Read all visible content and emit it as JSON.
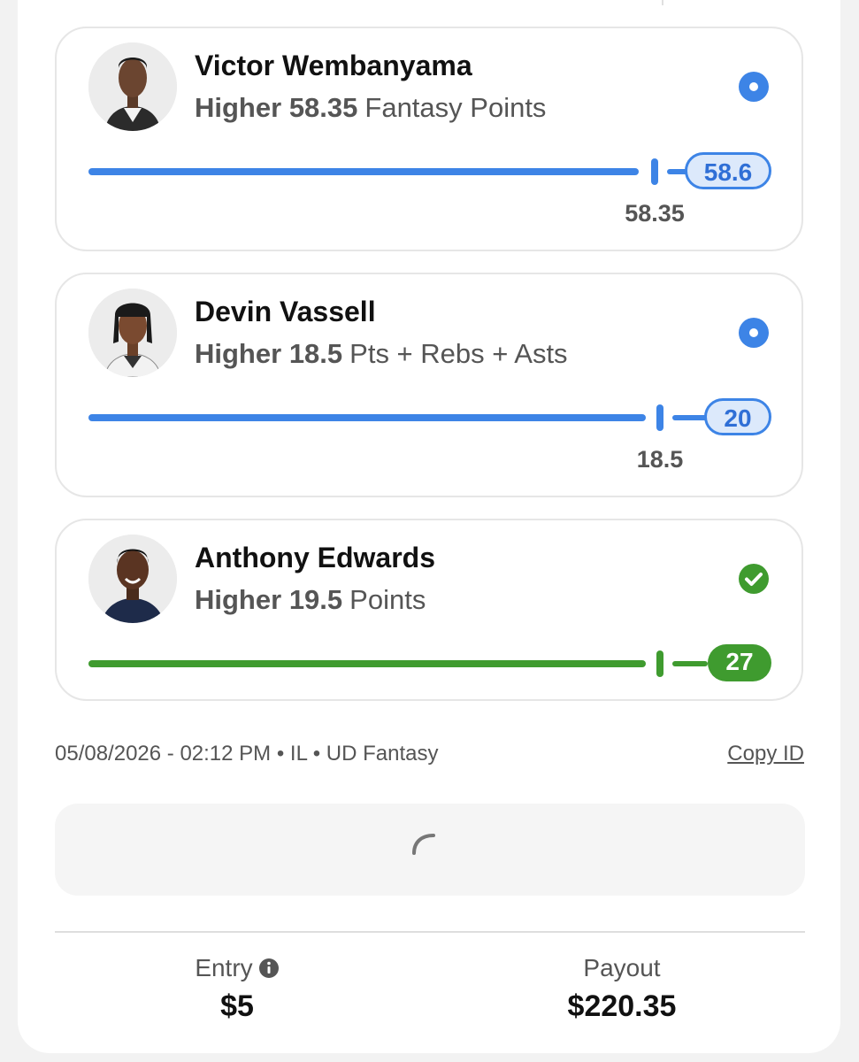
{
  "colors": {
    "blue_accent": "#3d84e6",
    "blue_pill_bg": "#dce9fb",
    "green_accent": "#3f9b2f",
    "text_dark": "#111111",
    "text_muted": "#555555"
  },
  "picks": [
    {
      "player": "Victor Wembanyama",
      "direction": "Higher",
      "line": "58.35",
      "stat": "Fantasy Points",
      "current_value": "58.6",
      "line_marker_label": "58.35",
      "status": "in-progress",
      "status_icon": "radio-dot-icon",
      "progress": 1.0
    },
    {
      "player": "Devin Vassell",
      "direction": "Higher",
      "line": "18.5",
      "stat": "Pts + Rebs + Asts",
      "current_value": "20",
      "line_marker_label": "18.5",
      "status": "in-progress",
      "status_icon": "radio-dot-icon",
      "progress": 1.0
    },
    {
      "player": "Anthony Edwards",
      "direction": "Higher",
      "line": "19.5",
      "stat": "Points",
      "current_value": "27",
      "line_marker_label": "",
      "status": "won",
      "status_icon": "check-circle-icon",
      "progress": 1.0
    }
  ],
  "entry_meta": "05/08/2026 - 02:12 PM • IL • UD Fantasy",
  "copy_id_label": "Copy ID",
  "summary": {
    "entry_label": "Entry",
    "entry_value": "$5",
    "payout_label": "Payout",
    "payout_value": "$220.35"
  }
}
